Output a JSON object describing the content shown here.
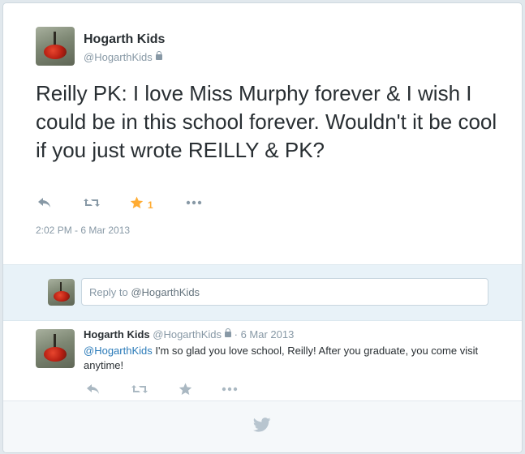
{
  "tweet": {
    "author_name": "Hogarth Kids",
    "author_handle": "@HogarthKids",
    "text": "Reilly PK: I love Miss Murphy forever & I wish I could be in this school forever. Wouldn't it be cool if you just wrote REILLY & PK?",
    "favorite_count": "1",
    "timestamp": "2:02 PM - 6 Mar 2013"
  },
  "reply_box": {
    "prefix": "Reply to ",
    "mention": "@HogarthKids"
  },
  "reply": {
    "author_name": "Hogarth Kids",
    "author_handle": "@HogarthKids",
    "date": "· 6 Mar 2013",
    "mention": "@HogarthKids",
    "text": " I'm so glad you love school, Reilly! After you graduate, you come visit anytime!"
  },
  "colors": {
    "accent_link": "#2b7bb9",
    "favorite": "#ffac33",
    "muted": "#8899a6"
  },
  "icons": [
    "reply-icon",
    "retweet-icon",
    "favorite-icon",
    "more-icon",
    "lock-icon",
    "twitter-bird-icon"
  ]
}
